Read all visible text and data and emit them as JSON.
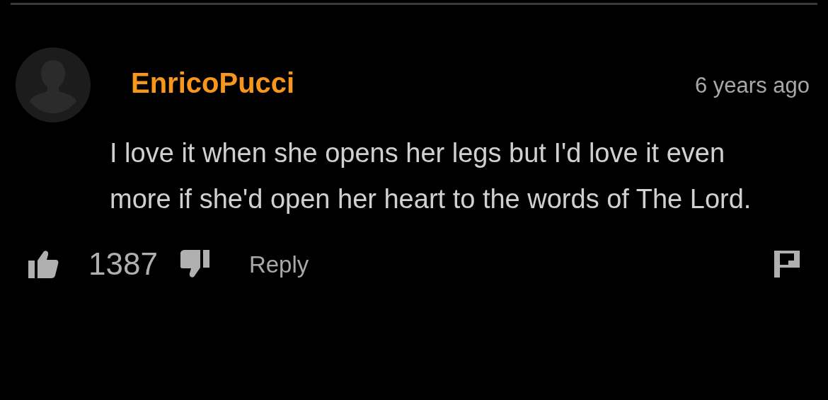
{
  "comment": {
    "author": "EnricoPucci",
    "time": "6 years ago",
    "text": "I love it when she opens her legs but I'd love it even more if she'd open her heart to the words of The Lord.",
    "likes": "1387",
    "reply": "Reply"
  }
}
